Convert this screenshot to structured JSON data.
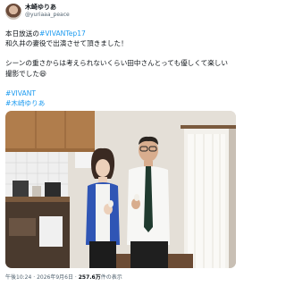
{
  "author": {
    "name": "木崎ゆりあ",
    "handle": "@yuriaaa_peace"
  },
  "tweet": {
    "line1_prefix": "本日放送の",
    "line1_hashtag": "#VIVANTep17",
    "line2": "和久井の妻役で出演させて頂きました！",
    "line3": "シーンの重さからは考えられないくらい田中さんとっても優しくて楽しい",
    "line4": "撮影でした😆",
    "hashtag1": "#VIVANT",
    "hashtag2": "#木崎ゆりあ"
  },
  "meta": {
    "time": "午後10:24",
    "date": "2026年9月6日",
    "views_count": "257.6万",
    "views_label": "件の表示",
    "separator": "·"
  },
  "colors": {
    "link": "#1d9bf0",
    "text": "#0f1419",
    "muted": "#536471"
  }
}
